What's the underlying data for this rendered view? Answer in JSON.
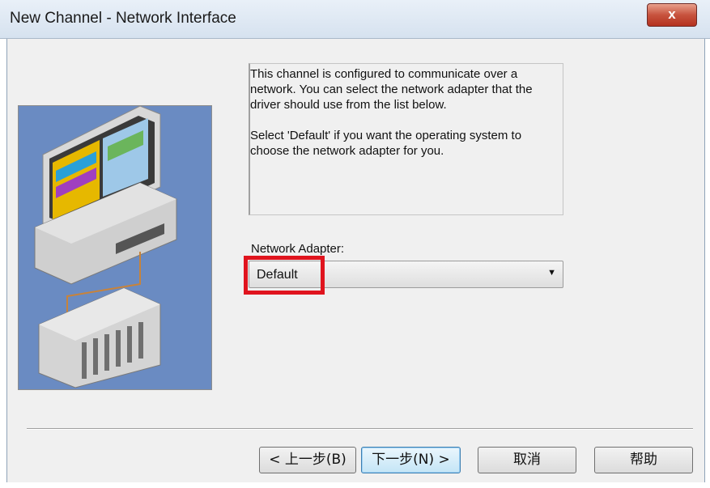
{
  "window": {
    "title": "New Channel - Network Interface",
    "close_label": "x"
  },
  "description": {
    "paragraph1": "This channel is configured to communicate over a network.  You can select the network adapter that the driver should use from the list below.",
    "paragraph2": "Select 'Default' if you want the operating system to choose the network adapter for you."
  },
  "network_adapter": {
    "label": "Network Adapter:",
    "selected": "Default"
  },
  "buttons": {
    "back": "< 上一步(B)",
    "next": "下一步(N) >",
    "cancel": "取消",
    "help": "帮助"
  },
  "colors": {
    "highlight": "#e0141e",
    "illustration_bg": "#6a8bc2"
  }
}
